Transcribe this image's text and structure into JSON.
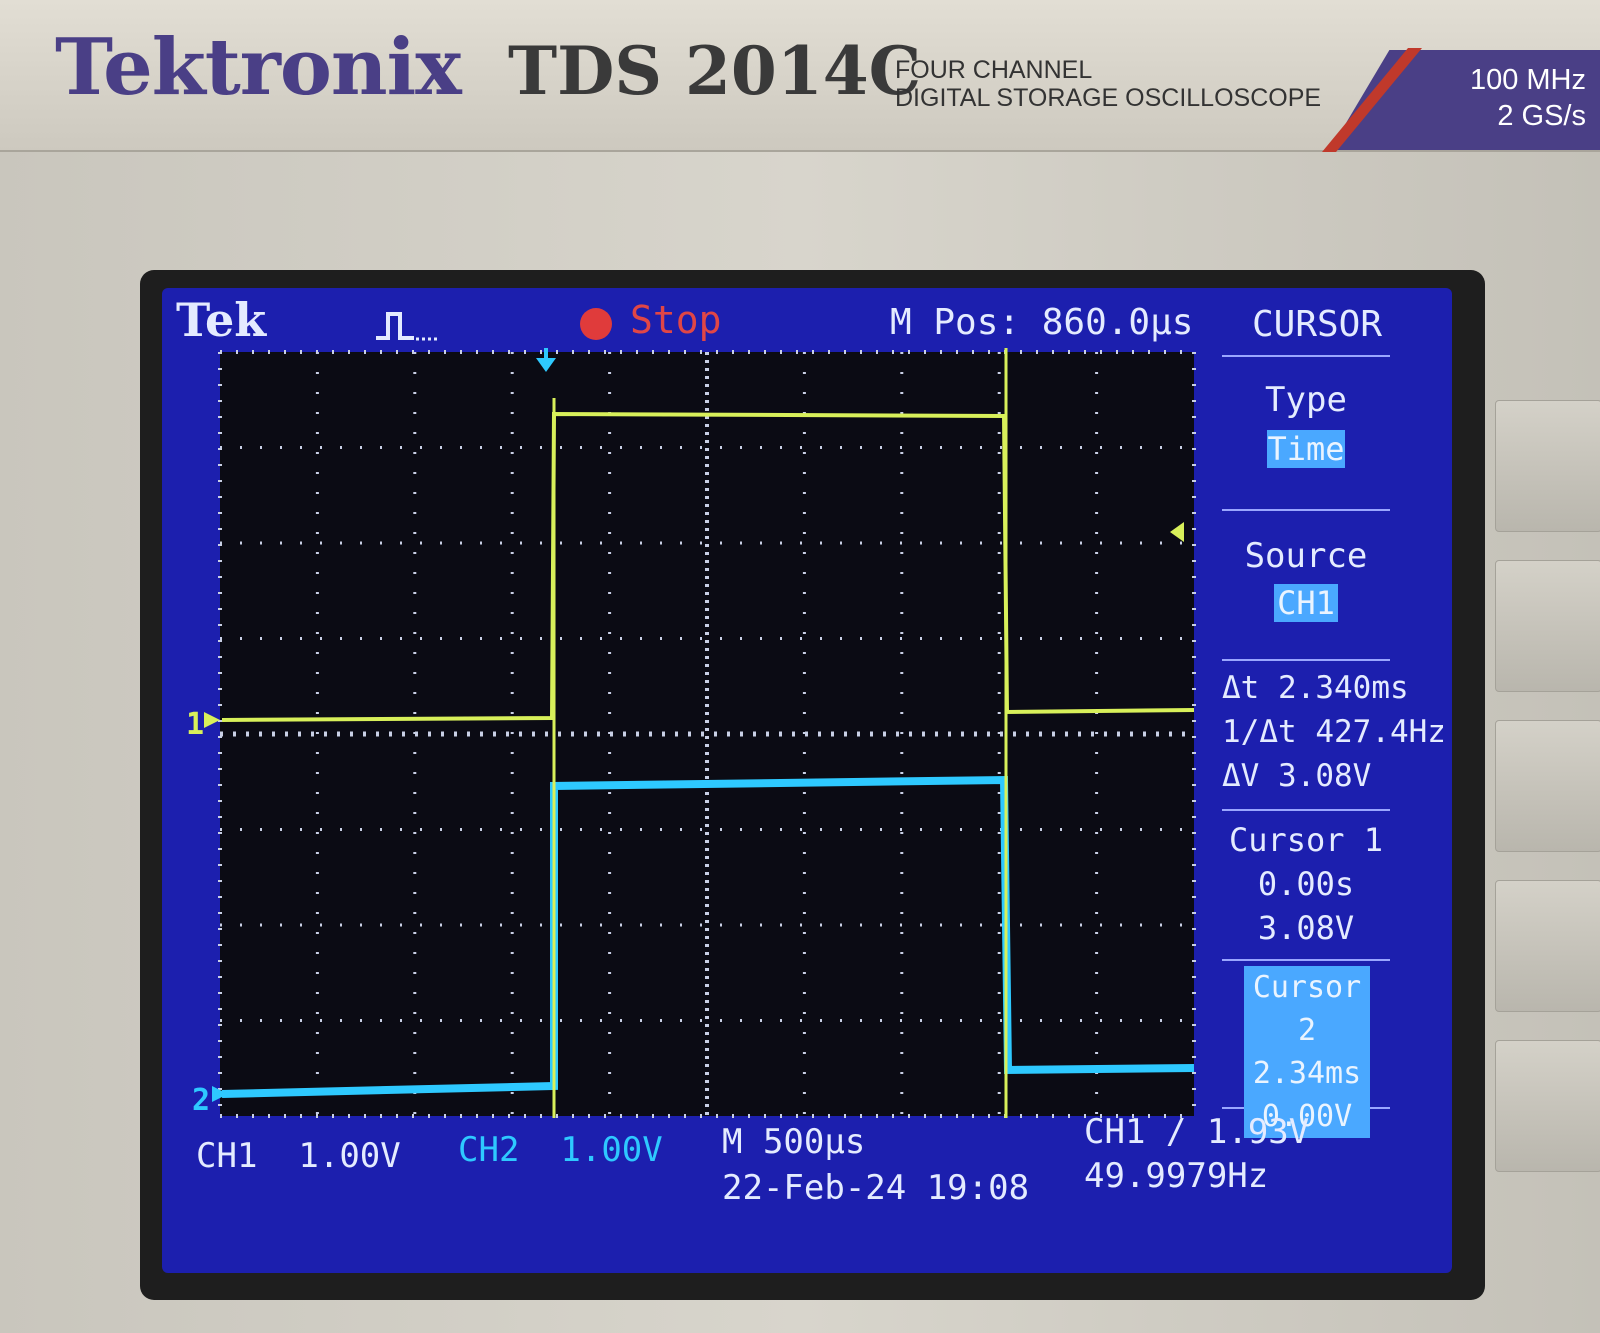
{
  "device": {
    "brand": "Tektronix",
    "model": "TDS 2014C",
    "description_line1": "FOUR CHANNEL",
    "description_line2": "DIGITAL STORAGE OSCILLOSCOPE",
    "bandwidth": "100 MHz",
    "sample_rate": "2 GS/s",
    "brand_color": "#4a3f86"
  },
  "display": {
    "logo": "Tek",
    "trigger_status": "Stop",
    "mpos": "M Pos: 860.0",
    "mpos_unit": "µs",
    "menu_title": "CURSOR",
    "colors": {
      "background": "#1c1fae",
      "ch1": "#d8f05a",
      "ch2": "#2ec9ff",
      "text": "#e4ebff"
    }
  },
  "menu": {
    "type_label": "Type",
    "type_value": "Time",
    "source_label": "Source",
    "source_value": "CH1",
    "delta_t": "2.340ms",
    "inverse_delta_t": "427.4Hz",
    "delta_v": "3.08V",
    "cursor1_label": "Cursor 1",
    "cursor1_time": "0.00s",
    "cursor1_volt": "3.08V",
    "cursor2_label": "Cursor 2",
    "cursor2_time": "2.34ms",
    "cursor2_volt": "0.00V"
  },
  "status": {
    "ch1_label": "CH1",
    "ch1_scale": "1.00V",
    "ch2_label": "CH2",
    "ch2_scale": "1.00V",
    "timebase": "M 500",
    "timebase_unit": "µs",
    "date_time": "22-Feb-24 19:08",
    "trigger_source": "CH1",
    "trigger_level": "1.93V",
    "frequency": "49.9979Hz"
  },
  "markers": {
    "ch1": "1",
    "ch2": "2"
  }
}
